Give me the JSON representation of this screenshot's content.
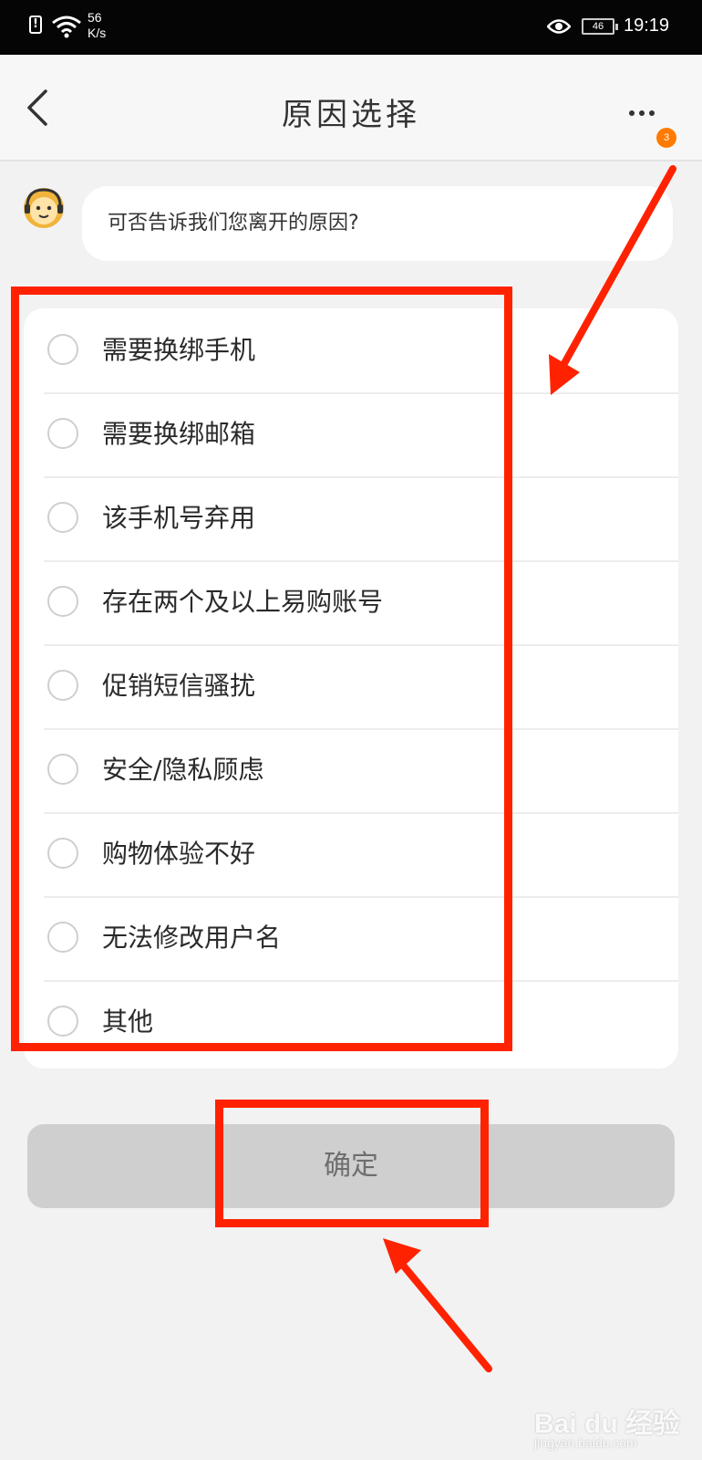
{
  "status_bar": {
    "alert_glyph": "!",
    "speed_value": "56",
    "speed_unit": "K/s",
    "battery": "46",
    "time": "19:19",
    "icons": [
      "alert-icon",
      "wifi-icon",
      "eye-icon",
      "battery-icon"
    ]
  },
  "header": {
    "title": "原因选择",
    "badge_count": "3",
    "icons": [
      "back-icon",
      "more-icon"
    ]
  },
  "chat": {
    "question": "可否告诉我们您离开的原因?"
  },
  "options": [
    {
      "label": "需要换绑手机",
      "selected": false
    },
    {
      "label": "需要换绑邮箱",
      "selected": false
    },
    {
      "label": "该手机号弃用",
      "selected": false
    },
    {
      "label": "存在两个及以上易购账号",
      "selected": false
    },
    {
      "label": "促销短信骚扰",
      "selected": false
    },
    {
      "label": "安全/隐私顾虑",
      "selected": false
    },
    {
      "label": "购物体验不好",
      "selected": false
    },
    {
      "label": "无法修改用户名",
      "selected": false
    },
    {
      "label": "其他",
      "selected": false
    }
  ],
  "confirm_label": "确定",
  "colors": {
    "annotation": "#ff2200",
    "badge": "#ff7a00",
    "confirm_bg": "#cfcfcf"
  },
  "watermark": {
    "logo": "Bai du 经验",
    "sub": "jingyan.baidu.com"
  }
}
